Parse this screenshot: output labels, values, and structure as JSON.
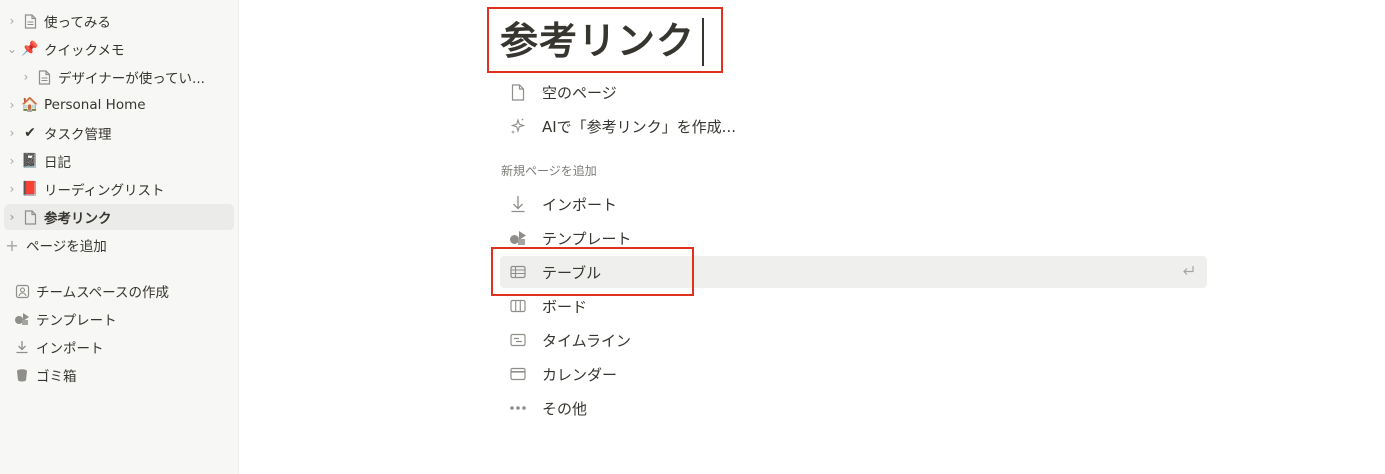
{
  "sidebar": {
    "pages": [
      {
        "label": "使ってみる",
        "icon": "page-icon",
        "indent": 0,
        "chevron": "right"
      },
      {
        "label": "クイックメモ",
        "icon": "pushpin-icon",
        "indent": 0,
        "chevron": "down"
      },
      {
        "label": "デザイナーが使ってい...",
        "icon": "page-icon",
        "indent": 1,
        "chevron": "right"
      },
      {
        "label": "Personal Home",
        "icon": "house-icon",
        "indent": 0,
        "chevron": "right"
      },
      {
        "label": "タスク管理",
        "icon": "check-mark-icon",
        "indent": 0,
        "chevron": "right"
      },
      {
        "label": "日記",
        "icon": "notebook-icon",
        "indent": 0,
        "chevron": "right"
      },
      {
        "label": "リーディングリスト",
        "icon": "book-icon",
        "indent": 0,
        "chevron": "right"
      },
      {
        "label": "参考リンク",
        "icon": "page-icon",
        "indent": 0,
        "chevron": "right",
        "active": true
      }
    ],
    "add_page_label": "ページを追加",
    "utilities": [
      {
        "label": "チームスペースの作成",
        "icon": "teamspace-icon"
      },
      {
        "label": "テンプレート",
        "icon": "template-icon"
      },
      {
        "label": "インポート",
        "icon": "import-icon"
      },
      {
        "label": "ゴミ箱",
        "icon": "trash-icon"
      }
    ]
  },
  "main": {
    "title": "参考リンク",
    "quick_actions": [
      {
        "label": "空のページ",
        "icon": "page-icon"
      },
      {
        "label": "AIで「参考リンク」を作成...",
        "icon": "sparkle-icon"
      }
    ],
    "section_label": "新規ページを追加",
    "add_items": [
      {
        "label": "インポート",
        "icon": "import-icon"
      },
      {
        "label": "テンプレート",
        "icon": "template-icon"
      },
      {
        "label": "テーブル",
        "icon": "table-icon",
        "hover": true
      },
      {
        "label": "ボード",
        "icon": "board-icon"
      },
      {
        "label": "タイムライン",
        "icon": "timeline-icon"
      },
      {
        "label": "カレンダー",
        "icon": "calendar-icon"
      },
      {
        "label": "その他",
        "icon": "more-icon"
      }
    ]
  },
  "colors": {
    "highlight_border": "#e0301e",
    "sidebar_bg": "#f7f7f5",
    "text": "#37352f"
  }
}
